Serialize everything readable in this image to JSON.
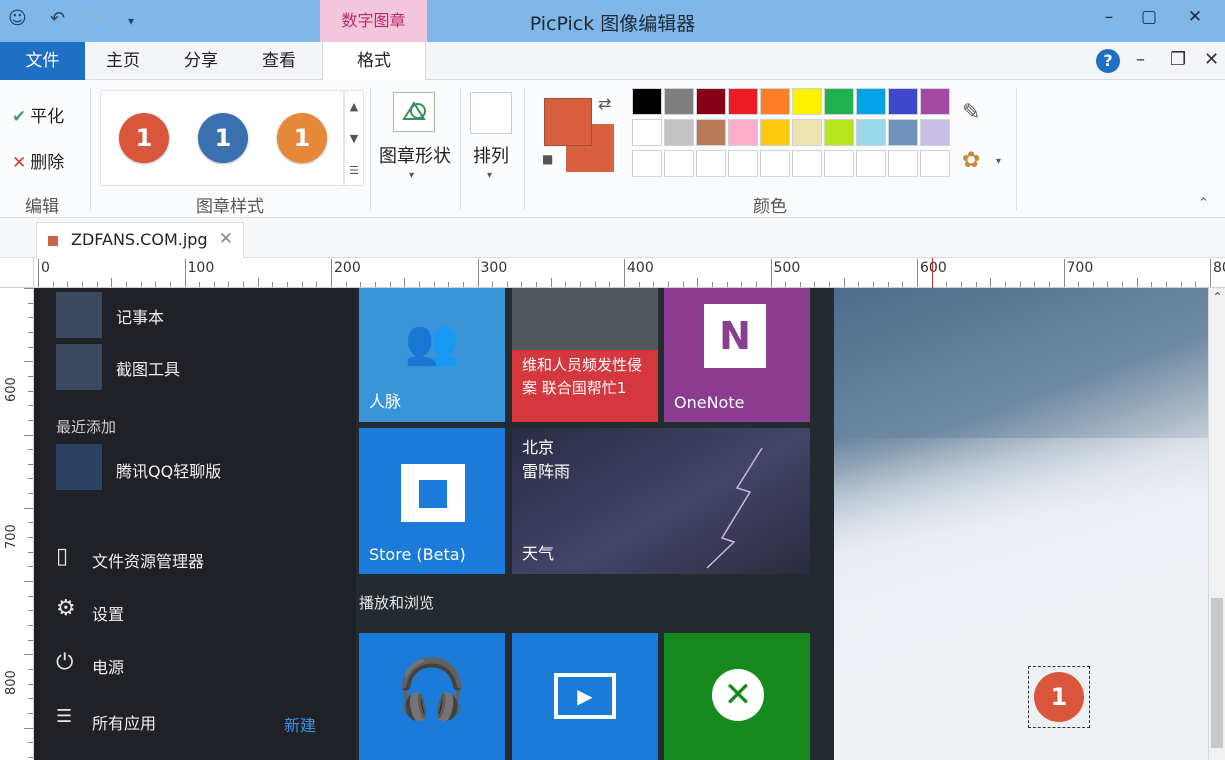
{
  "window": {
    "title": "PicPick 图像编辑器",
    "context_tab": "数字图章"
  },
  "tabs": [
    {
      "label": "文件"
    },
    {
      "label": "主页"
    },
    {
      "label": "分享"
    },
    {
      "label": "查看"
    },
    {
      "label": "格式"
    }
  ],
  "ribbon": {
    "edit_group": {
      "label": "编辑",
      "apply": "平化",
      "delete": "删除"
    },
    "stamp_style_group": {
      "label": "图章样式",
      "stamps": [
        {
          "text": "1",
          "color": "#d9553b"
        },
        {
          "text": "1",
          "color": "#3b6fb0"
        },
        {
          "text": "1",
          "color": "#e5883a"
        }
      ]
    },
    "stamp_shape": "图章形状",
    "arrange": "排列",
    "color_group": {
      "label": "颜色",
      "primary": "#d9603f",
      "secondary": "#d9603f",
      "swatches_row1": [
        "#000000",
        "#7f7f7f",
        "#880015",
        "#ed1c24",
        "#ff7f27",
        "#fff200",
        "#22b14c",
        "#00a2e8",
        "#3f48cc",
        "#a349a4"
      ],
      "swatches_row2": [
        "#ffffff",
        "#c3c3c3",
        "#b97a57",
        "#ffaec9",
        "#ffc90e",
        "#efe4b0",
        "#b5e61d",
        "#99d9ea",
        "#7092be",
        "#c8bfe7"
      ],
      "swatches_row3": [
        "#ffffff",
        "#ffffff",
        "#ffffff",
        "#ffffff",
        "#ffffff",
        "#ffffff",
        "#ffffff",
        "#ffffff",
        "#ffffff",
        "#ffffff"
      ]
    }
  },
  "document_tab": {
    "name": "ZDFANS.COM.jpg"
  },
  "ruler": {
    "top": [
      "0",
      "100",
      "200",
      "300",
      "400",
      "500",
      "600",
      "700",
      "80"
    ],
    "left": [
      "600",
      "700",
      "800"
    ]
  },
  "start_menu": {
    "apps": [
      {
        "label": "记事本"
      },
      {
        "label": "截图工具"
      }
    ],
    "recent_label": "最近添加",
    "recent_app": "腾讯QQ轻聊版",
    "file_explorer": "文件资源管理器",
    "settings": "设置",
    "power": "电源",
    "all_apps": "所有应用",
    "new": "新建",
    "section_label": "播放和浏览",
    "tiles": {
      "people": "人脉",
      "news": "维和人员频发性侵案 联合国帮忙1",
      "onenote": "OneNote",
      "store": "Store (Beta)",
      "weather_city": "北京",
      "weather_desc": "雷阵雨",
      "weather": "天气"
    }
  },
  "selected_stamp": {
    "text": "1"
  }
}
